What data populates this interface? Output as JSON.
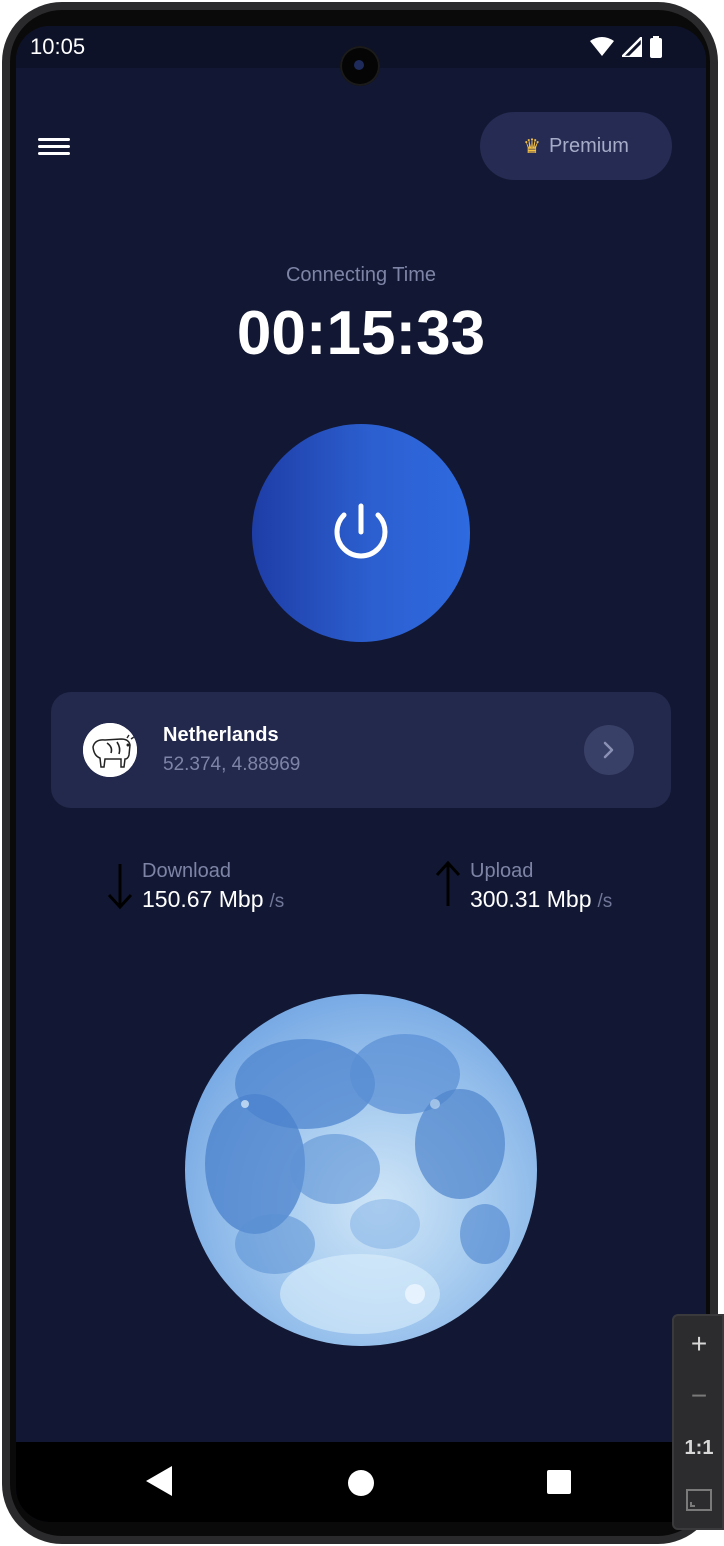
{
  "status_bar": {
    "time": "10:05",
    "icons": [
      "wifi-icon",
      "cellular-signal-icon",
      "battery-icon"
    ]
  },
  "header": {
    "menu_icon": "hamburger-menu-icon",
    "premium_label": "Premium",
    "premium_icon": "crown-icon"
  },
  "connection": {
    "label": "Connecting Time",
    "timer": "00:15:33",
    "power_icon": "power-icon"
  },
  "server": {
    "country": "Netherlands",
    "coordinates": "52.374, 4.88969",
    "flag_icon": "cow-flag-icon",
    "chevron_icon": "chevron-right-icon"
  },
  "stats": {
    "download": {
      "label": "Download",
      "value": "150.67 Mbp",
      "unit": "/s",
      "icon": "arrow-down-icon"
    },
    "upload": {
      "label": "Upload",
      "value": "300.31 Mbp",
      "unit": "/s",
      "icon": "arrow-up-icon"
    }
  },
  "illustration": {
    "name": "moon-image"
  },
  "nav": {
    "icons": [
      "back-icon",
      "home-icon",
      "recents-icon"
    ]
  },
  "zoom_controls": {
    "plus": "+",
    "minus": "−",
    "one_to_one": "1:1",
    "fit_icon": "fit-screen-icon"
  },
  "colors": {
    "background": "#121833",
    "card": "#23294d",
    "accent": "#2e6ae0",
    "muted_text": "#7d84a6"
  }
}
